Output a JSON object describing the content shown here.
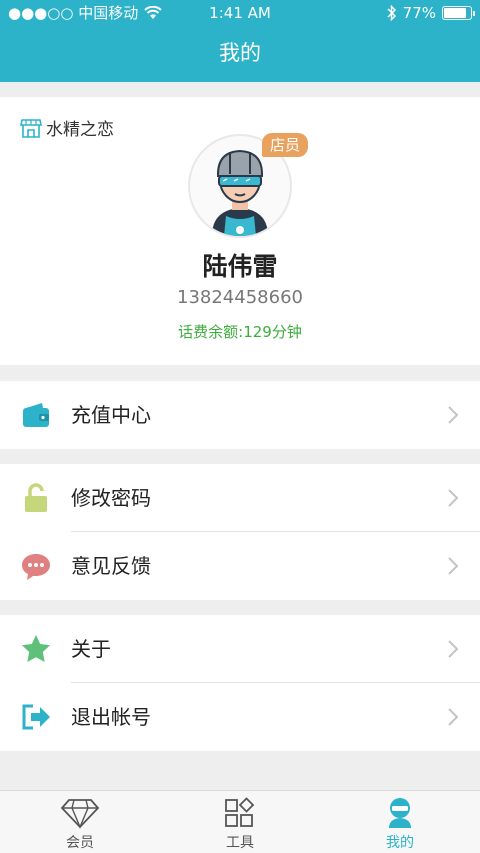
{
  "status_bar": {
    "carrier": "●●●○○ 中国移动",
    "time": "1:41 AM",
    "battery": "77%",
    "battery_level": 0.77
  },
  "header": {
    "title": "我的"
  },
  "profile": {
    "store_name": "水精之恋",
    "role_badge": "店员",
    "name": "陆伟雷",
    "phone": "13824458660",
    "balance": "话费余额:129分钟"
  },
  "menu": {
    "recharge": "充值中心",
    "change_password": "修改密码",
    "feedback": "意见反馈",
    "about": "关于",
    "logout": "退出帐号"
  },
  "tabs": [
    {
      "label": "会员",
      "icon": "diamond-icon"
    },
    {
      "label": "工具",
      "icon": "grid-icon"
    },
    {
      "label": "我的",
      "icon": "person-icon"
    }
  ],
  "colors": {
    "accent": "#2cb3c9",
    "balance_green": "#3cae3c",
    "badge_orange": "#e8a25e"
  }
}
